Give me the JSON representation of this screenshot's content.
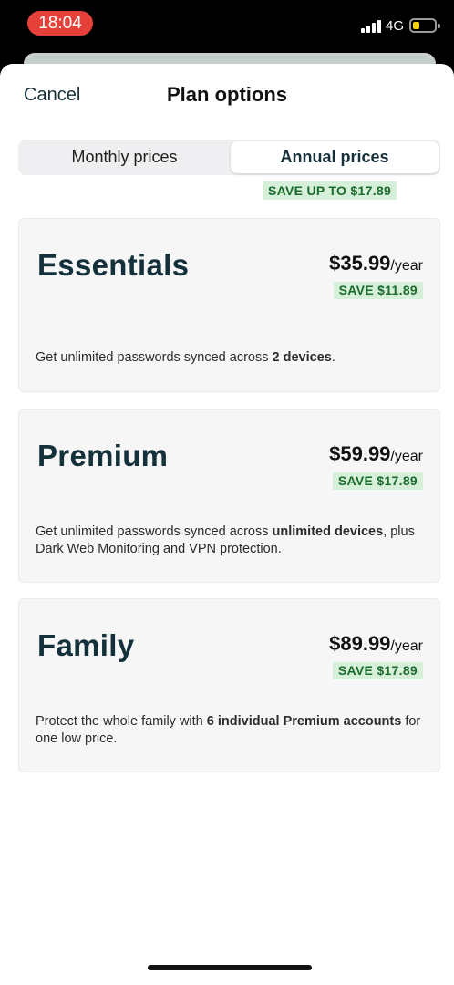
{
  "status_bar": {
    "time": "18:04",
    "network": "4G"
  },
  "header": {
    "cancel_label": "Cancel",
    "title": "Plan options"
  },
  "toggle": {
    "monthly_label": "Monthly prices",
    "annual_label": "Annual prices",
    "selected": "Annual prices",
    "save_banner": "SAVE UP TO $17.89"
  },
  "plans": [
    {
      "name": "Essentials",
      "price": "$35.99",
      "period": "/year",
      "save": "SAVE $11.89",
      "desc_pre": "Get unlimited passwords synced across ",
      "desc_bold1": "2 devices",
      "desc_mid": ".",
      "desc_bold2": "",
      "desc_post": ""
    },
    {
      "name": "Premium",
      "price": "$59.99",
      "period": "/year",
      "save": "SAVE $17.89",
      "desc_pre": "Get unlimited passwords synced across ",
      "desc_bold1": "unlimited devices",
      "desc_mid": ", plus Dark Web Monitoring and VPN protection.",
      "desc_bold2": "",
      "desc_post": ""
    },
    {
      "name": "Family",
      "price": "$89.99",
      "period": "/year",
      "save": "SAVE $17.89",
      "desc_pre": "Protect the whole family with ",
      "desc_bold1": "6 individual Premium accounts",
      "desc_mid": " for one low price.",
      "desc_bold2": "",
      "desc_post": ""
    }
  ],
  "colors": {
    "accent_dark": "#14303a",
    "save_bg": "#d6efd9",
    "save_text": "#1a6a2c",
    "time_pill": "#e5413a"
  }
}
